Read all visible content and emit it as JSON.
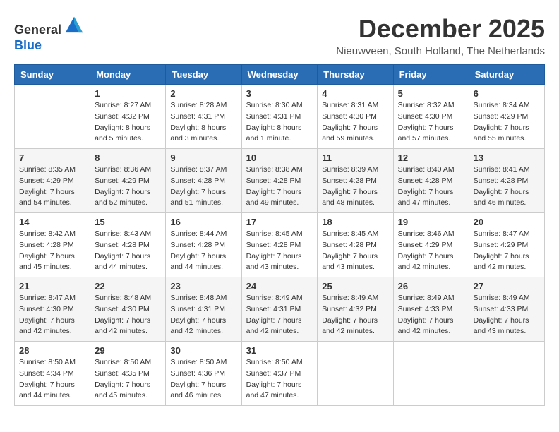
{
  "header": {
    "logo_line1": "General",
    "logo_line2": "Blue",
    "month_title": "December 2025",
    "location": "Nieuwveen, South Holland, The Netherlands"
  },
  "weekdays": [
    "Sunday",
    "Monday",
    "Tuesday",
    "Wednesday",
    "Thursday",
    "Friday",
    "Saturday"
  ],
  "weeks": [
    [
      {
        "day": "",
        "info": ""
      },
      {
        "day": "1",
        "info": "Sunrise: 8:27 AM\nSunset: 4:32 PM\nDaylight: 8 hours\nand 5 minutes."
      },
      {
        "day": "2",
        "info": "Sunrise: 8:28 AM\nSunset: 4:31 PM\nDaylight: 8 hours\nand 3 minutes."
      },
      {
        "day": "3",
        "info": "Sunrise: 8:30 AM\nSunset: 4:31 PM\nDaylight: 8 hours\nand 1 minute."
      },
      {
        "day": "4",
        "info": "Sunrise: 8:31 AM\nSunset: 4:30 PM\nDaylight: 7 hours\nand 59 minutes."
      },
      {
        "day": "5",
        "info": "Sunrise: 8:32 AM\nSunset: 4:30 PM\nDaylight: 7 hours\nand 57 minutes."
      },
      {
        "day": "6",
        "info": "Sunrise: 8:34 AM\nSunset: 4:29 PM\nDaylight: 7 hours\nand 55 minutes."
      }
    ],
    [
      {
        "day": "7",
        "info": "Sunrise: 8:35 AM\nSunset: 4:29 PM\nDaylight: 7 hours\nand 54 minutes."
      },
      {
        "day": "8",
        "info": "Sunrise: 8:36 AM\nSunset: 4:29 PM\nDaylight: 7 hours\nand 52 minutes."
      },
      {
        "day": "9",
        "info": "Sunrise: 8:37 AM\nSunset: 4:28 PM\nDaylight: 7 hours\nand 51 minutes."
      },
      {
        "day": "10",
        "info": "Sunrise: 8:38 AM\nSunset: 4:28 PM\nDaylight: 7 hours\nand 49 minutes."
      },
      {
        "day": "11",
        "info": "Sunrise: 8:39 AM\nSunset: 4:28 PM\nDaylight: 7 hours\nand 48 minutes."
      },
      {
        "day": "12",
        "info": "Sunrise: 8:40 AM\nSunset: 4:28 PM\nDaylight: 7 hours\nand 47 minutes."
      },
      {
        "day": "13",
        "info": "Sunrise: 8:41 AM\nSunset: 4:28 PM\nDaylight: 7 hours\nand 46 minutes."
      }
    ],
    [
      {
        "day": "14",
        "info": "Sunrise: 8:42 AM\nSunset: 4:28 PM\nDaylight: 7 hours\nand 45 minutes."
      },
      {
        "day": "15",
        "info": "Sunrise: 8:43 AM\nSunset: 4:28 PM\nDaylight: 7 hours\nand 44 minutes."
      },
      {
        "day": "16",
        "info": "Sunrise: 8:44 AM\nSunset: 4:28 PM\nDaylight: 7 hours\nand 44 minutes."
      },
      {
        "day": "17",
        "info": "Sunrise: 8:45 AM\nSunset: 4:28 PM\nDaylight: 7 hours\nand 43 minutes."
      },
      {
        "day": "18",
        "info": "Sunrise: 8:45 AM\nSunset: 4:28 PM\nDaylight: 7 hours\nand 43 minutes."
      },
      {
        "day": "19",
        "info": "Sunrise: 8:46 AM\nSunset: 4:29 PM\nDaylight: 7 hours\nand 42 minutes."
      },
      {
        "day": "20",
        "info": "Sunrise: 8:47 AM\nSunset: 4:29 PM\nDaylight: 7 hours\nand 42 minutes."
      }
    ],
    [
      {
        "day": "21",
        "info": "Sunrise: 8:47 AM\nSunset: 4:30 PM\nDaylight: 7 hours\nand 42 minutes."
      },
      {
        "day": "22",
        "info": "Sunrise: 8:48 AM\nSunset: 4:30 PM\nDaylight: 7 hours\nand 42 minutes."
      },
      {
        "day": "23",
        "info": "Sunrise: 8:48 AM\nSunset: 4:31 PM\nDaylight: 7 hours\nand 42 minutes."
      },
      {
        "day": "24",
        "info": "Sunrise: 8:49 AM\nSunset: 4:31 PM\nDaylight: 7 hours\nand 42 minutes."
      },
      {
        "day": "25",
        "info": "Sunrise: 8:49 AM\nSunset: 4:32 PM\nDaylight: 7 hours\nand 42 minutes."
      },
      {
        "day": "26",
        "info": "Sunrise: 8:49 AM\nSunset: 4:33 PM\nDaylight: 7 hours\nand 42 minutes."
      },
      {
        "day": "27",
        "info": "Sunrise: 8:49 AM\nSunset: 4:33 PM\nDaylight: 7 hours\nand 43 minutes."
      }
    ],
    [
      {
        "day": "28",
        "info": "Sunrise: 8:50 AM\nSunset: 4:34 PM\nDaylight: 7 hours\nand 44 minutes."
      },
      {
        "day": "29",
        "info": "Sunrise: 8:50 AM\nSunset: 4:35 PM\nDaylight: 7 hours\nand 45 minutes."
      },
      {
        "day": "30",
        "info": "Sunrise: 8:50 AM\nSunset: 4:36 PM\nDaylight: 7 hours\nand 46 minutes."
      },
      {
        "day": "31",
        "info": "Sunrise: 8:50 AM\nSunset: 4:37 PM\nDaylight: 7 hours\nand 47 minutes."
      },
      {
        "day": "",
        "info": ""
      },
      {
        "day": "",
        "info": ""
      },
      {
        "day": "",
        "info": ""
      }
    ]
  ]
}
